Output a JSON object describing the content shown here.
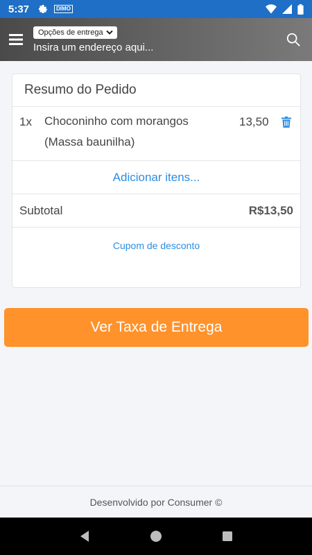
{
  "status_bar": {
    "time": "5:37",
    "mini_logo": "DIMO"
  },
  "header": {
    "delivery_options_label": "Opções de entrega",
    "address_placeholder": "Insira um endereço aqui..."
  },
  "order": {
    "title": "Resumo do Pedido",
    "items": [
      {
        "qty": "1x",
        "name": "Choconinho com morangos",
        "detail": "(Massa baunilha)",
        "price": "13,50"
      }
    ],
    "add_items_label": "Adicionar itens...",
    "subtotal_label": "Subtotal",
    "subtotal_value": "R$13,50",
    "coupon_label": "Cupom de desconto"
  },
  "cta_label": "Ver Taxa de Entrega",
  "footer_text": "Desenvolvido por Consumer ©",
  "colors": {
    "status_bar": "#1e6fc5",
    "accent_blue": "#2b8de3",
    "cta_orange": "#ff922b"
  }
}
